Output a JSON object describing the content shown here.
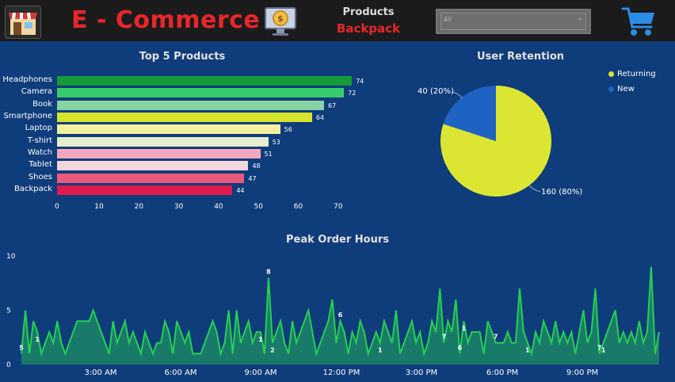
{
  "header": {
    "title": "E - Commerce",
    "filter_label": "Products",
    "filter_selected": "Backpack",
    "dropdown_value": "All",
    "icons": [
      "store-icon",
      "money-monitor-icon",
      "shopping-cart-icon"
    ]
  },
  "colors": {
    "background": "#0f3c7a",
    "header_bg": "#1b1b1b",
    "title_red": "#e8262a",
    "line_green": "#23d150",
    "area_fill": "#1a7a6a",
    "pie_returning": "#dce632",
    "pie_new": "#1e63c2"
  },
  "top_products": {
    "title": "Top 5 Products",
    "chart_data": {
      "type": "bar",
      "categories": [
        "Headphones",
        "Camera",
        "Book",
        "Smartphone",
        "Laptop",
        "T-shirt",
        "Watch",
        "Tablet",
        "Shoes",
        "Backpack"
      ],
      "values": [
        74,
        72,
        67,
        64,
        56,
        53,
        51,
        48,
        47,
        44
      ],
      "bar_colors": [
        "#169a3a",
        "#36cc6b",
        "#88d3a1",
        "#d4e22a",
        "#f2f09c",
        "#e3eecf",
        "#f2a8bc",
        "#f1d6dc",
        "#e8597c",
        "#e11a4e"
      ],
      "xticks": [
        "0",
        "10",
        "20",
        "30",
        "40",
        "50",
        "60",
        "70"
      ],
      "xlim": [
        0,
        75
      ]
    }
  },
  "user_retention": {
    "title": "User Retention",
    "chart_data": {
      "type": "pie",
      "slices": [
        {
          "name": "Returning",
          "value": 160,
          "label": "160 (80%)"
        },
        {
          "name": "New",
          "value": 40,
          "label": "40 (20%)"
        }
      ],
      "legend_placement": "top-right"
    }
  },
  "peak_hours": {
    "title": "Peak Order Hours",
    "chart_data": {
      "type": "area",
      "yticks": [
        "0",
        "5",
        "10"
      ],
      "ylim": [
        0,
        10
      ],
      "xticks": [
        "3:00 AM",
        "6:00 AM",
        "9:00 AM",
        "12:00 PM",
        "3:00 PM",
        "6:00 PM",
        "9:00 PM"
      ],
      "values": [
        1,
        5,
        1,
        4,
        3,
        1,
        2,
        3,
        2,
        4,
        2,
        1,
        2,
        3,
        4,
        4,
        4,
        4,
        5,
        4,
        3,
        2,
        1,
        4,
        2,
        3,
        4,
        2,
        3,
        2,
        1,
        3,
        2,
        1,
        2,
        2,
        4,
        3,
        1,
        4,
        3,
        2,
        3,
        1,
        1,
        1,
        2,
        3,
        4,
        3,
        1,
        2,
        5,
        1,
        5,
        2,
        3,
        4,
        2,
        3,
        3,
        1,
        8,
        2,
        3,
        4,
        2,
        1,
        4,
        2,
        3,
        4,
        5,
        3,
        1,
        2,
        3,
        4,
        6,
        2,
        4,
        3,
        1,
        3,
        2,
        4,
        3,
        1,
        2,
        3,
        2,
        4,
        3,
        2,
        5,
        1,
        2,
        3,
        4,
        2,
        3,
        1,
        2,
        4,
        3,
        7,
        2,
        4,
        3,
        6,
        1,
        4,
        2,
        3,
        3,
        3,
        1,
        4,
        3,
        2,
        2,
        2,
        3,
        2,
        2,
        7,
        3,
        2,
        1,
        3,
        2,
        4,
        3,
        2,
        4,
        2,
        3,
        2,
        3,
        1,
        3,
        5,
        2,
        3,
        7,
        1,
        2,
        3,
        4,
        5,
        2,
        3,
        2,
        3,
        2,
        4,
        2,
        3,
        9,
        1,
        3
      ],
      "point_labels": [
        {
          "index": 0,
          "text": "5"
        },
        {
          "index": 4,
          "text": "1"
        },
        {
          "index": 62,
          "text": "8"
        },
        {
          "index": 63,
          "text": "2"
        },
        {
          "index": 60,
          "text": "1"
        },
        {
          "index": 80,
          "text": "6"
        },
        {
          "index": 90,
          "text": "1"
        },
        {
          "index": 106,
          "text": "7"
        },
        {
          "index": 110,
          "text": "6"
        },
        {
          "index": 111,
          "text": "1"
        },
        {
          "index": 119,
          "text": "7"
        },
        {
          "index": 127,
          "text": "1"
        },
        {
          "index": 145,
          "text": "7"
        },
        {
          "index": 146,
          "text": "1"
        },
        {
          "index": 161,
          "text": "9"
        },
        {
          "index": 162,
          "text": "3"
        }
      ]
    }
  }
}
